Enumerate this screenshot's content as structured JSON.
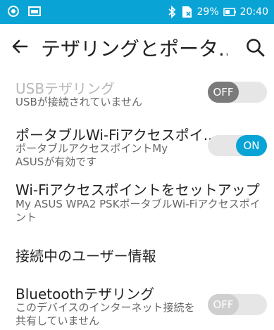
{
  "status_bar": {
    "battery": "29%",
    "time": "20:40",
    "icons": [
      "wifi-hotspot-icon",
      "gallery-icon",
      "bluetooth-icon",
      "sim-no-signal-icon",
      "battery-icon"
    ]
  },
  "app_bar": {
    "title": "テザリングとポータ..."
  },
  "items": [
    {
      "title": "USBテザリング",
      "subtitle": "USBが接続されていません",
      "toggle": "OFF",
      "enabled": false
    },
    {
      "title": "ポータブルWi-Fiアクセスポイ..",
      "subtitle": "ポータブルアクセスポイントMy ASUSが有効です",
      "toggle": "ON",
      "enabled": true
    },
    {
      "title": "Wi-Fiアクセスポイントをセットアップ",
      "subtitle": "My ASUS WPA2 PSKポータブルWi-Fiアクセスポイント",
      "enabled": true
    },
    {
      "title": "接続中のユーザー情報",
      "enabled": true
    },
    {
      "title": "Bluetoothテザリング",
      "subtitle": "このデバイスのインターネット接続を共有していません",
      "toggle": "OFF",
      "enabled": true
    }
  ],
  "colors": {
    "accent": "#0aa3d6",
    "status_bar": "#0aa3d6"
  }
}
